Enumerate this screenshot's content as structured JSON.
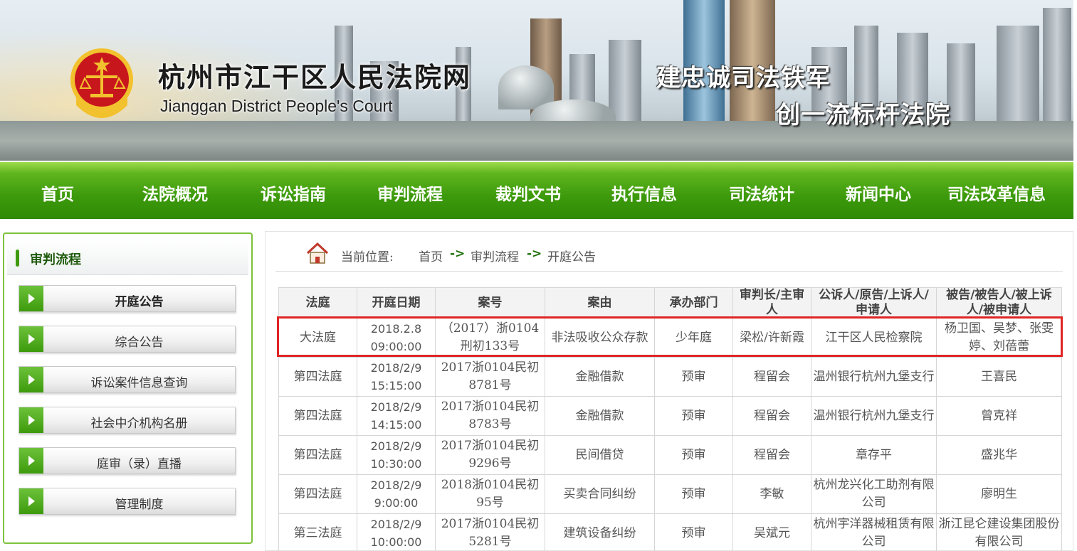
{
  "site": {
    "title": "杭州市江干区人民法院网",
    "subtitle": "Jianggan District People's Court",
    "slogan_1": "建忠诚司法铁军",
    "slogan_2": "创一流标杆法院"
  },
  "nav": {
    "items": [
      "首页",
      "法院概况",
      "诉讼指南",
      "审判流程",
      "裁判文书",
      "执行信息",
      "司法统计",
      "新闻中心",
      "司法改革信息"
    ]
  },
  "sidebar": {
    "title": "审判流程",
    "items": [
      "开庭公告",
      "综合公告",
      "诉讼案件信息查询",
      "社会中介机构名册",
      "庭审（录）直播",
      "管理制度"
    ],
    "active_index": 0
  },
  "breadcrumb": {
    "prefix": "当前位置:",
    "items": [
      "首页",
      "审判流程",
      "开庭公告"
    ],
    "separator": "->"
  },
  "table": {
    "headers": [
      "法庭",
      "开庭日期",
      "案号",
      "案由",
      "承办部门",
      "审判长/主审人",
      "公诉人/原告/上诉人/申请人",
      "被告/被告人/被上诉人/被申请人"
    ],
    "rows": [
      [
        "大法庭",
        "2018.2.8 09:00:00",
        "（2017）浙0104刑初133号",
        "非法吸收公众存款",
        "少年庭",
        "梁松/许新霞",
        "江干区人民检察院",
        "杨卫国、吴梦、张雯婷、刘蓓蕾"
      ],
      [
        "第四法庭",
        "2018/2/9 15:15:00",
        "2017浙0104民初8781号",
        "金融借款",
        "预审",
        "程留会",
        "温州银行杭州九堡支行",
        "王喜民"
      ],
      [
        "第四法庭",
        "2018/2/9 14:15:00",
        "2017浙0104民初8783号",
        "金融借款",
        "预审",
        "程留会",
        "温州银行杭州九堡支行",
        "曾克祥"
      ],
      [
        "第四法庭",
        "2018/2/9 10:30:00",
        "2017浙0104民初9296号",
        "民间借贷",
        "预审",
        "程留会",
        "章存平",
        "盛兆华"
      ],
      [
        "第四法庭",
        "2018/2/9 9:00:00",
        "2018浙0104民初95号",
        "买卖合同纠纷",
        "预审",
        "李敏",
        "杭州龙兴化工助剂有限公司",
        "廖明生"
      ],
      [
        "第三法庭",
        "2018/2/9 10:00:00",
        "2017浙0104民初5281号",
        "建筑设备纠纷",
        "预审",
        "吴斌元",
        "杭州宇洋器械租赁有限公司",
        "浙江昆仑建设集团股份有限公司"
      ]
    ]
  },
  "colors": {
    "nav_green": "#3d9a0c",
    "highlight_red": "#e02525",
    "emblem_red": "#c8161d",
    "emblem_gold": "#f2c12e"
  }
}
